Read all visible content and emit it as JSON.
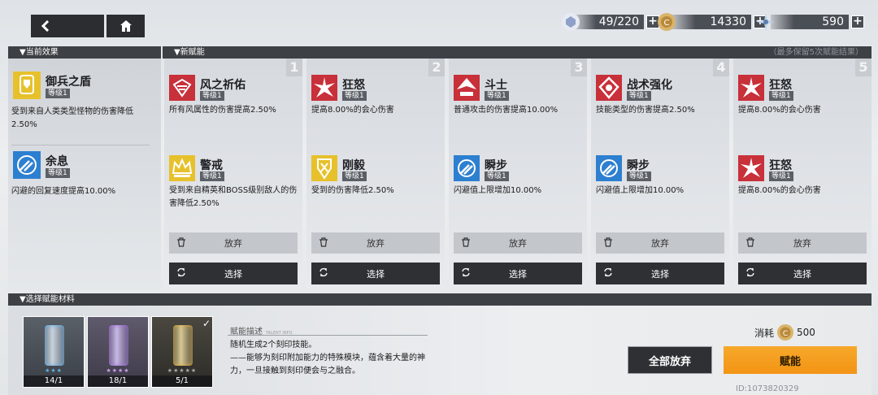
{
  "topbar": {
    "back_icon": "back-arrow-icon",
    "home_icon": "home-icon",
    "resources": [
      {
        "name": "stamina",
        "icon": "stamina-icon",
        "value": "49/220"
      },
      {
        "name": "coin",
        "icon": "coin-icon",
        "value": "14330"
      },
      {
        "name": "crystal",
        "icon": "crystal-icon",
        "value": "590"
      }
    ]
  },
  "current_effects": {
    "header": "▼当前效果",
    "items": [
      {
        "name": "御兵之盾",
        "level": "等级1",
        "desc": "受到来自人类类型怪物的伤害降低2.50%",
        "icon": "shield-icon",
        "color": "#e7c12c"
      },
      {
        "name": "余息",
        "level": "等级1",
        "desc": "闪避的回复速度提高10.00%",
        "icon": "dash-icon",
        "color": "#2d7fd0"
      }
    ]
  },
  "new_talents": {
    "header": "▼新赋能",
    "note": "（最多保留5次赋能结果）",
    "columns": [
      {
        "number": "1",
        "top": {
          "name": "风之祈佑",
          "level": "等级1",
          "desc": "所有风属性的伤害提高2.50%",
          "icon": "wind-icon",
          "color": "#c8303a"
        },
        "bottom": {
          "name": "警戒",
          "level": "等级1",
          "desc": "受到来自精英和BOSS级别敌人的伤害降低2.50%",
          "icon": "crown-icon",
          "color": "#e7c12c"
        },
        "discard": "放弃",
        "choose": "选择"
      },
      {
        "number": "2",
        "top": {
          "name": "狂怒",
          "level": "等级1",
          "desc": "提高8.00%的会心伤害",
          "icon": "burst-icon",
          "color": "#c8303a"
        },
        "bottom": {
          "name": "刚毅",
          "level": "等级1",
          "desc": "受到的伤害降低2.50%",
          "icon": "spike-shield-icon",
          "color": "#e7c12c"
        },
        "discard": "放弃",
        "choose": "选择"
      },
      {
        "number": "3",
        "top": {
          "name": "斗士",
          "level": "等级1",
          "desc": "普通攻击的伤害提高10.00%",
          "icon": "fighter-icon",
          "color": "#c8303a"
        },
        "bottom": {
          "name": "瞬步",
          "level": "等级1",
          "desc": "闪避值上限增加10.00%",
          "icon": "dash-icon",
          "color": "#2d7fd0"
        },
        "discard": "放弃",
        "choose": "选择"
      },
      {
        "number": "4",
        "top": {
          "name": "战术强化",
          "level": "等级1",
          "desc": "技能类型的伤害提高2.50%",
          "icon": "tactics-icon",
          "color": "#c8303a"
        },
        "bottom": {
          "name": "瞬步",
          "level": "等级1",
          "desc": "闪避值上限增加10.00%",
          "icon": "dash-icon",
          "color": "#2d7fd0"
        },
        "discard": "放弃",
        "choose": "选择"
      },
      {
        "number": "5",
        "top": {
          "name": "狂怒",
          "level": "等级1",
          "desc": "提高8.00%的会心伤害",
          "icon": "burst-icon",
          "color": "#c8303a"
        },
        "bottom": {
          "name": "狂怒",
          "level": "等级1",
          "desc": "提高8.00%的会心伤害",
          "icon": "burst-icon",
          "color": "#c8303a"
        },
        "discard": "放弃",
        "choose": "选择"
      }
    ]
  },
  "materials": {
    "header": "▼选择赋能材料",
    "items": [
      {
        "count": "14/1",
        "stars": "★★★",
        "tier_color": "#5fb0e8",
        "selected": false
      },
      {
        "count": "18/1",
        "stars": "★★★★",
        "tier_color": "#a46be0",
        "selected": false
      },
      {
        "count": "5/1",
        "stars": "★★★★★",
        "tier_color": "#e0b040",
        "selected": true
      }
    ]
  },
  "description": {
    "title": "赋能描述",
    "subtitle": "TALENT INFO",
    "text": "随机生成2个刻印技能。\n——能够为刻印附加能力的特殊模块，蕴含着大量的神力，一旦接触到刻印便会与之融合。"
  },
  "cost": {
    "label": "消耗",
    "icon": "coin-icon",
    "value": "500"
  },
  "buttons": {
    "discard_all": "全部放弃",
    "empower": "赋能"
  },
  "uid": "ID:1073820329"
}
